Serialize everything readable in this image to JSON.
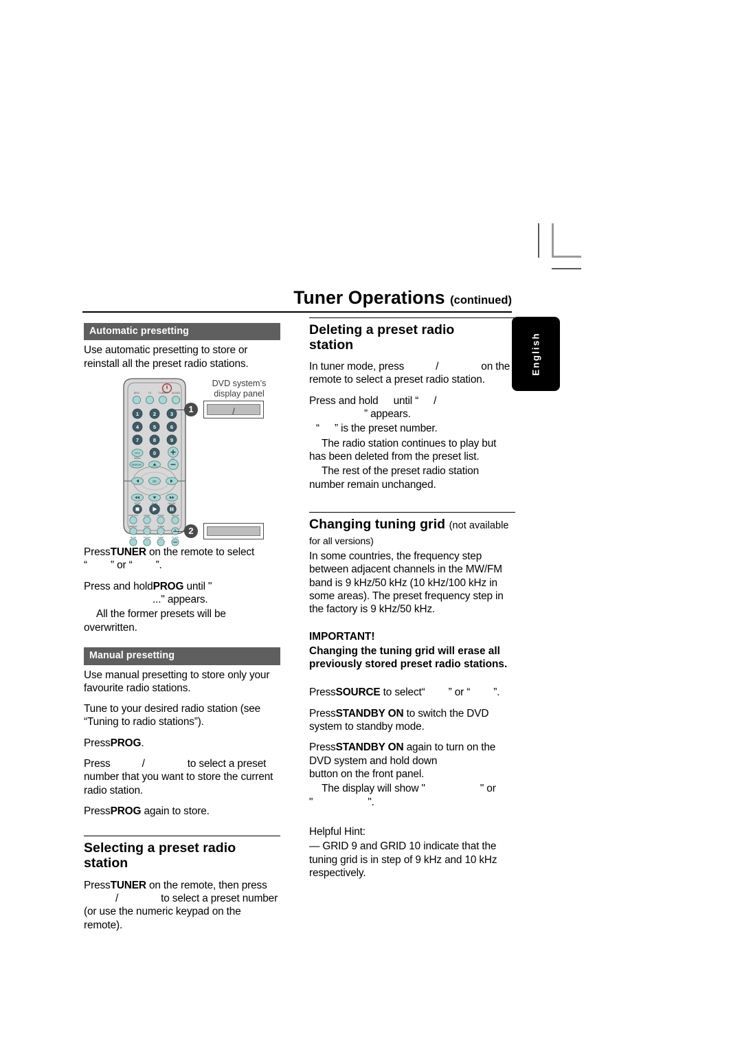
{
  "page": {
    "title": "Tuner Operations",
    "title_suffix": "(continued)",
    "side_tab": "English"
  },
  "figure": {
    "caption_line1": "DVD system’s",
    "caption_line2": "display panel",
    "callout_1": "1",
    "callout_2": "2",
    "display_1_text": "/",
    "display_2_text": "",
    "remote": {
      "power_icon": "power-icon",
      "source_buttons": [
        "DISC",
        "TV",
        "TUNER",
        "AUX/DI"
      ],
      "keypad": [
        "1",
        "2",
        "3",
        "4",
        "5",
        "6",
        "7",
        "8",
        "9",
        "0"
      ],
      "disc_menu": "DISC\nMENU",
      "display": "DISPLAY",
      "volume": "VOL",
      "vol_plus": "+",
      "vol_minus": "−",
      "ok": "OK",
      "transport_labels": [
        "STOP",
        "PLAY",
        "PAUSE"
      ],
      "row_subtitle": [
        "SUBTITLE",
        "AUDIO",
        "ZOOM",
        "SET-UP"
      ],
      "row_repeat": [
        "REPEAT",
        "PROG",
        "SLEEP"
      ],
      "row_mute": [
        "MUTE",
        "SOUND",
        "SURR",
        "TV VOL"
      ]
    }
  },
  "left_column": {
    "auto_heading": "Automatic presetting",
    "auto_intro": "Use automatic presetting to store or reinstall all the preset radio stations.",
    "auto_step1_a": "Press",
    "auto_step1_bold": "TUNER",
    "auto_step1_b": " on the remote to select",
    "auto_step1_c": "“",
    "auto_step1_d": "” or “",
    "auto_step1_e": "”.",
    "auto_step2_a": "Press and hold",
    "auto_step2_bold": "PROG",
    "auto_step2_b": " until \"",
    "auto_step2_c": "...\" appears.",
    "auto_step2_note": "All the former presets will be overwritten.",
    "manual_heading": "Manual presetting",
    "manual_intro": "Use manual presetting to store only your favourite radio stations.",
    "manual_step1": "Tune to your desired radio station (see “Tuning to radio stations”).",
    "manual_step2_a": "Press",
    "manual_step2_bold": "PROG",
    "manual_step2_b": ".",
    "manual_step3_a": "Press",
    "manual_step3_sep": "/",
    "manual_step3_b": "to select a preset number that you want to store the current radio station.",
    "manual_step4_a": "Press",
    "manual_step4_bold": "PROG",
    "manual_step4_b": " again to store.",
    "selecting_heading_l1": "Selecting a preset radio",
    "selecting_heading_l2": "station",
    "selecting_body_a": "Press",
    "selecting_body_bold": "TUNER",
    "selecting_body_b": " on the remote, then press",
    "selecting_body_sep": "/",
    "selecting_body_c": "to select a preset number (or use the numeric keypad on the remote)."
  },
  "right_column": {
    "deleting_heading_l1": "Deleting a preset radio",
    "deleting_heading_l2": "station",
    "deleting_step1_a": "In tuner mode, press",
    "deleting_step1_sep": "/",
    "deleting_step1_b": "on the remote to select a preset radio station.",
    "deleting_step2_a": "Press and hold",
    "deleting_step2_b": "until “",
    "deleting_step2_sep": "/",
    "deleting_step2_c": "” appears.",
    "deleting_note1_a": "“",
    "deleting_note1_b": "” is the preset number.",
    "deleting_note2": "The radio station continues to play but has been deleted from the preset list.",
    "deleting_note3": "The rest of the preset radio station number remain unchanged.",
    "grid_heading": "Changing tuning grid",
    "grid_heading_sub": "(not available",
    "grid_heading_sub2": "for all versions)",
    "grid_body": "In some countries, the frequency step between adjacent channels in the MW/FM band is 9 kHz/50 kHz (10 kHz/100 kHz in some areas). The preset frequency step in the factory is 9 kHz/50 kHz.",
    "important_title": "IMPORTANT!",
    "important_body": "Changing the tuning grid will erase all previously stored preset radio stations.",
    "grid_step1_a": "Press",
    "grid_step1_bold": "SOURCE",
    "grid_step1_b": " to select",
    "grid_step1_c": "“",
    "grid_step1_d": "” or “",
    "grid_step1_e": "”.",
    "grid_step2_a": "Press",
    "grid_step2_bold": "STANDBY ON",
    "grid_step2_b": " to switch the DVD system to standby mode.",
    "grid_step3_a": "Press",
    "grid_step3_bold": "STANDBY ON",
    "grid_step3_b": " again to turn on the DVD system and hold down",
    "grid_step3_c": "button on the front panel.",
    "grid_step3_note_a": "The display will show \"",
    "grid_step3_note_b": "\" or",
    "grid_step3_note_c": "\"",
    "grid_step3_note_d": "\".",
    "hint_title": "Helpful Hint:",
    "hint_body": "— GRID 9 and GRID 10 indicate that the tuning grid is in step of 9 kHz and 10 kHz respectively."
  },
  "colors": {
    "section_bar": "#5f5f5f",
    "tab_background": "#000000",
    "remote_body": "#d9d9d9",
    "remote_button": "#a9d5d3",
    "display_panel": "#bdbdbd"
  }
}
